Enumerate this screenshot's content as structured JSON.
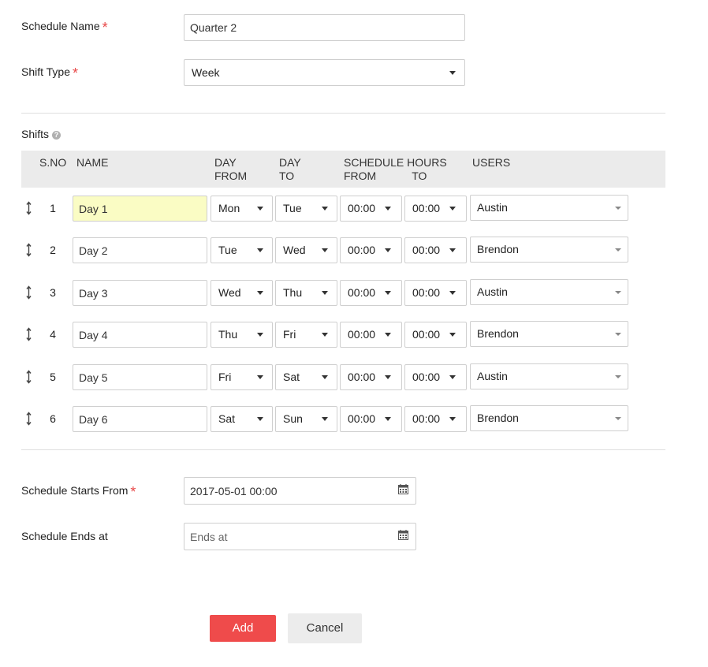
{
  "form": {
    "schedule_name": {
      "label": "Schedule Name",
      "value": "Quarter 2"
    },
    "shift_type": {
      "label": "Shift Type",
      "value": "Week"
    },
    "required_mark": "*"
  },
  "shifts": {
    "title": "Shifts",
    "help": "?",
    "headers": {
      "sno": "S.NO",
      "name": "NAME",
      "day_from_1": "DAY",
      "day_from_2": "FROM",
      "day_to_1": "DAY",
      "day_to_2": "TO",
      "hours_1": "SCHEDULE HOURS",
      "hours_from": "FROM",
      "hours_to": "TO",
      "users": "USERS"
    },
    "rows": [
      {
        "sno": "1",
        "name": "Day 1",
        "day_from": "Mon",
        "day_to": "Tue",
        "time_from": "00:00",
        "time_to": "00:00",
        "user": "Austin"
      },
      {
        "sno": "2",
        "name": "Day 2",
        "day_from": "Tue",
        "day_to": "Wed",
        "time_from": "00:00",
        "time_to": "00:00",
        "user": "Brendon"
      },
      {
        "sno": "3",
        "name": "Day 3",
        "day_from": "Wed",
        "day_to": "Thu",
        "time_from": "00:00",
        "time_to": "00:00",
        "user": "Austin"
      },
      {
        "sno": "4",
        "name": "Day 4",
        "day_from": "Thu",
        "day_to": "Fri",
        "time_from": "00:00",
        "time_to": "00:00",
        "user": "Brendon"
      },
      {
        "sno": "5",
        "name": "Day 5",
        "day_from": "Fri",
        "day_to": "Sat",
        "time_from": "00:00",
        "time_to": "00:00",
        "user": "Austin"
      },
      {
        "sno": "6",
        "name": "Day 6",
        "day_from": "Sat",
        "day_to": "Sun",
        "time_from": "00:00",
        "time_to": "00:00",
        "user": "Brendon"
      }
    ],
    "highlight_color": "#fafcc4"
  },
  "schedule": {
    "starts_from": {
      "label": "Schedule Starts From",
      "value": "2017-05-01 00:00"
    },
    "ends_at": {
      "label": "Schedule Ends at",
      "placeholder": "Ends at",
      "value": ""
    }
  },
  "actions": {
    "add": "Add",
    "cancel": "Cancel"
  },
  "colors": {
    "accent": "#ef4b4b",
    "required": "#e84848"
  }
}
